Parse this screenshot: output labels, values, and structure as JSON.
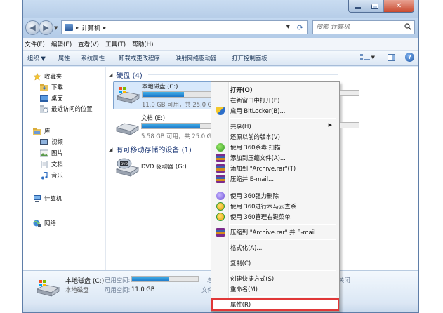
{
  "window": {
    "address": {
      "root_label": "计算机"
    },
    "search_placeholder": "搜索 计算机"
  },
  "menubar": [
    "文件(F)",
    "编辑(E)",
    "查看(V)",
    "工具(T)",
    "帮助(H)"
  ],
  "toolbar": {
    "organize": "组织 ▼",
    "properties": "属性",
    "system_properties": "系统属性",
    "uninstall": "卸载或更改程序",
    "map_drive": "映射网络驱动器",
    "control_panel": "打开控制面板"
  },
  "navpane": {
    "favorites": "收藏夹",
    "downloads": "下载",
    "desktop": "桌面",
    "recent": "最近访问的位置",
    "libraries": "库",
    "videos": "视频",
    "pictures": "图片",
    "documents": "文档",
    "music": "音乐",
    "computer": "计算机",
    "network": "网络"
  },
  "content": {
    "hdd_group": "硬盘 (4)",
    "removable_group": "有可移动存储的设备 (1)",
    "drives": [
      {
        "name": "本地磁盘 (C:)",
        "size": "11.0 GB 可用，共 25.0 GB",
        "used_fraction": 0.56
      },
      {
        "name": "文档 (E:)",
        "size": "5.58 GB 可用，共 25.0 GB",
        "used_fraction": 0.78
      }
    ],
    "dvd": {
      "name": "DVD 驱动器 (G:)"
    }
  },
  "details": {
    "title": "本地磁盘 (C:)",
    "subtitle": "本地磁盘",
    "used_label": "已用空间:",
    "free_label": "可用空间:",
    "free_value": "11.0 GB",
    "total_label": "总",
    "fs_label": "文件",
    "bitlocker_label": "关闭",
    "used_fraction": 0.56
  },
  "context_menu": {
    "open": "打开(O)",
    "open_new_window": "在新窗口中打开(E)",
    "bitlocker": "启用 BitLocker(B)...",
    "share": "共享(H)",
    "restore": "还原以前的版本(V)",
    "scan_360": "使用 360杀毒 扫描",
    "add_archive": "添加到压缩文件(A)...",
    "add_archive_rar": "添加到 \"Archive.rar\"(T)",
    "compress_email": "压缩并 E-mail...",
    "force_delete": "使用 360强力删除",
    "trojan_scan": "使用 360进行木马云查杀",
    "manage_menu": "使用 360管理右键菜单",
    "compress_rar_email": "压缩到 \"Archive.rar\" 并 E-mail",
    "format": "格式化(A)...",
    "copy": "复制(C)",
    "create_shortcut": "创建快捷方式(S)",
    "rename": "重命名(M)",
    "properties": "属性(R)"
  },
  "colors": {
    "highlight_outline": "#e03737",
    "drive_bar": "#1b76c8",
    "group_header": "#1e3a78"
  }
}
